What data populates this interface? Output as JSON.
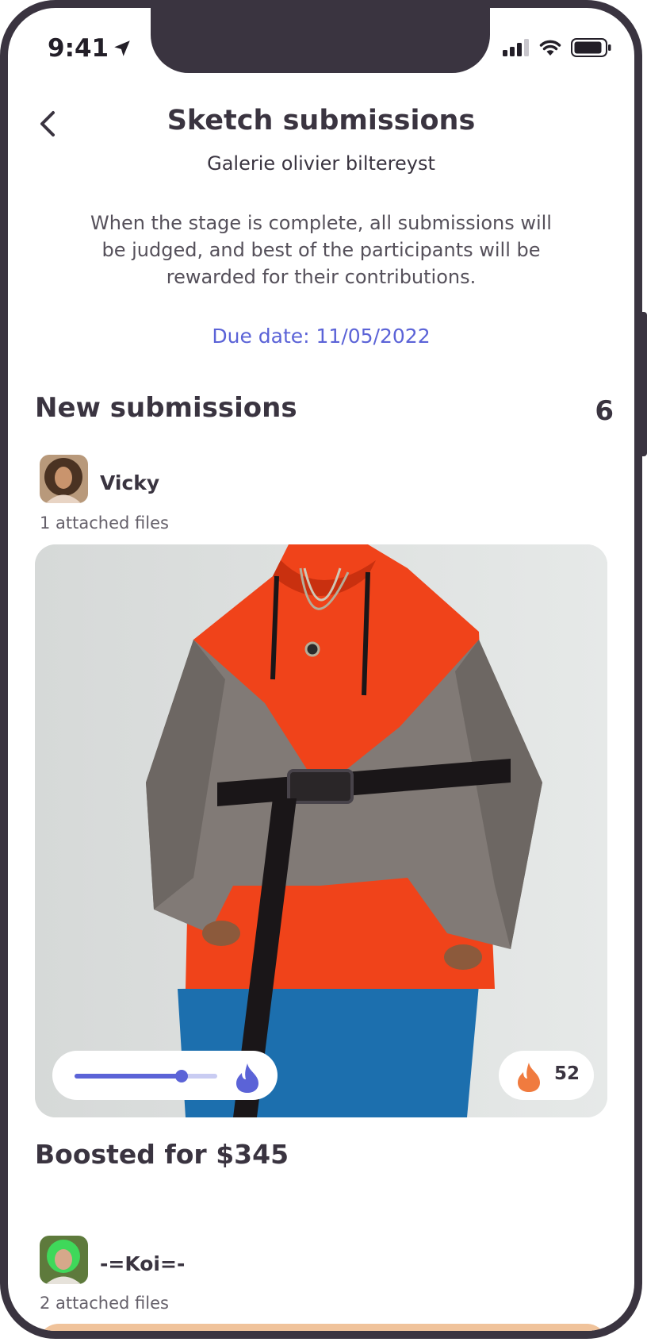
{
  "status_bar": {
    "time": "9:41"
  },
  "header": {
    "title": "Sketch submissions",
    "subtitle": "Galerie olivier biltereyst"
  },
  "description": "When the stage is complete, all submissions will be judged, and best of the participants will be rewarded for their contributions.",
  "due_date": "Due date: 11/05/2022",
  "section": {
    "title": "New submissions",
    "count": "6"
  },
  "submissions": [
    {
      "user": "Vicky",
      "files": "1 attached files",
      "boost_level": 0.75,
      "likes": "52",
      "boost_text": "Boosted for $345"
    },
    {
      "user": "-=Koi=-",
      "files": "2 attached files"
    }
  ],
  "colors": {
    "accent": "#5b63d7",
    "flame": "#f07b3f",
    "text": "#3a3440",
    "frame": "#3a3440"
  }
}
